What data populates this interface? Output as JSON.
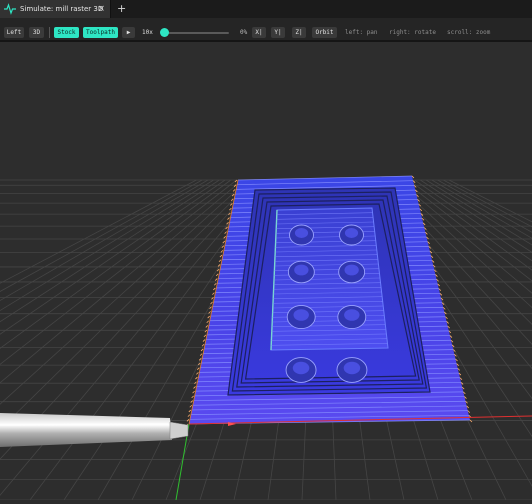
{
  "tab": {
    "title": "Simulate: mill raster 3D",
    "close": "×",
    "new_tab": "+"
  },
  "toolbar": {
    "left_label": "Left",
    "view_3d_label": "3D",
    "stock_label": "Stock",
    "toolpath_label": "Toolpath",
    "play_icon": "play-icon",
    "play_glyph": "▶",
    "speed_label": "10x",
    "progress": 0,
    "progress_label": "0%",
    "x_label": "X|",
    "y_label": "Y|",
    "z_label": "Z|",
    "orbit_label": "Orbit",
    "hint_left": "left: pan",
    "hint_right": "right: rotate",
    "hint_scroll": "scroll: zoom"
  },
  "colors": {
    "accent": "#2ee6c4",
    "stock_blue": "#4040e8",
    "toolpath_orange": "#ffb070",
    "axis_x": "#e03030",
    "axis_y": "#30c030"
  }
}
